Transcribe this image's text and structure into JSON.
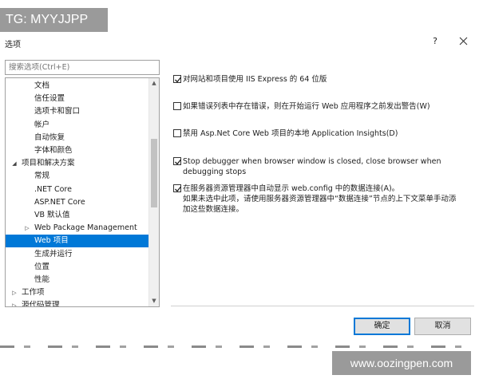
{
  "watermarks": {
    "top": "TG: MYYJJPP",
    "bottom": "www.oozingpen.com"
  },
  "window": {
    "title": "选项",
    "help": "?",
    "close": "close-icon"
  },
  "search": {
    "placeholder": "搜索选项(Ctrl+E)"
  },
  "tree": {
    "items": [
      {
        "label": "文档",
        "level": 2,
        "expander": ""
      },
      {
        "label": "信任设置",
        "level": 2,
        "expander": ""
      },
      {
        "label": "选项卡和窗口",
        "level": 2,
        "expander": ""
      },
      {
        "label": "帐户",
        "level": 2,
        "expander": ""
      },
      {
        "label": "自动恢复",
        "level": 2,
        "expander": ""
      },
      {
        "label": "字体和颜色",
        "level": 2,
        "expander": ""
      },
      {
        "label": "项目和解决方案",
        "level": 1,
        "expander": "expanded"
      },
      {
        "label": "常规",
        "level": 2,
        "expander": ""
      },
      {
        "label": ".NET Core",
        "level": 2,
        "expander": ""
      },
      {
        "label": "ASP.NET Core",
        "level": 2,
        "expander": ""
      },
      {
        "label": "VB 默认值",
        "level": 2,
        "expander": ""
      },
      {
        "label": "Web Package Management",
        "level": 2,
        "expander": "collapsed"
      },
      {
        "label": "Web 项目",
        "level": 2,
        "expander": "",
        "selected": true
      },
      {
        "label": "生成并运行",
        "level": 2,
        "expander": ""
      },
      {
        "label": "位置",
        "level": 2,
        "expander": ""
      },
      {
        "label": "性能",
        "level": 2,
        "expander": ""
      },
      {
        "label": "工作项",
        "level": 1,
        "expander": "collapsed"
      },
      {
        "label": "源代码管理",
        "level": 1,
        "expander": "collapsed"
      }
    ]
  },
  "options": [
    {
      "checked": true,
      "lines": [
        "对网站和项目使用 IIS Express 的 64 位版"
      ]
    },
    {
      "checked": false,
      "lines": [
        "如果错误列表中存在错误，则在开始运行 Web 应用程序之前发出警告(W)"
      ]
    },
    {
      "checked": false,
      "lines": [
        "禁用 Asp.Net Core Web 项目的本地 Application Insights(D)"
      ]
    },
    {
      "checked": true,
      "lines": [
        "Stop debugger when browser window is closed, close browser when",
        "debugging stops"
      ]
    },
    {
      "checked": true,
      "lines": [
        "在服务器资源管理器中自动显示 web.config 中的数据连接(A)。",
        "如果未选中此项，请使用服务器资源管理器中“数据连接”节点的上下文菜单手动添",
        "加这些数据连接。"
      ]
    }
  ],
  "buttons": {
    "ok": "确定",
    "cancel": "取消"
  },
  "colors": {
    "selection": "#0078d7",
    "button": "#e1e1e1",
    "watermark": "#9a9a9a"
  }
}
